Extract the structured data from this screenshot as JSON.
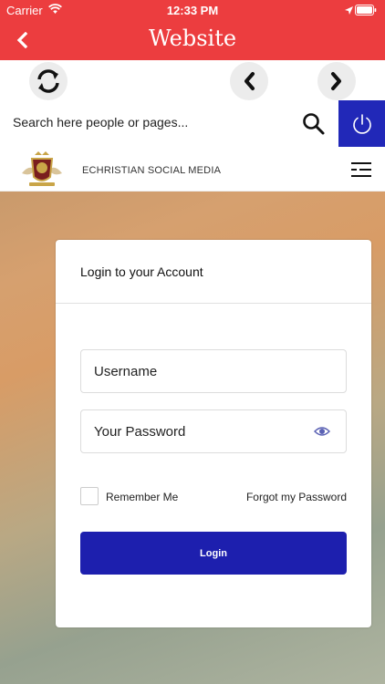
{
  "status_bar": {
    "carrier": "Carrier",
    "time": "12:33 PM"
  },
  "nav": {
    "title": "Website"
  },
  "search": {
    "placeholder": "Search here people or pages..."
  },
  "site": {
    "name": "ECHRISTIAN SOCIAL MEDIA"
  },
  "login": {
    "title": "Login to your Account",
    "username_placeholder": "Username",
    "password_placeholder": "Your Password",
    "remember_label": "Remember Me",
    "forgot_label": "Forgot my Password",
    "button_label": "Login"
  },
  "colors": {
    "header_red": "#ec3d3f",
    "power_blue": "#2128b8",
    "login_blue": "#1d1fae"
  },
  "icons": [
    "wifi-icon",
    "location-icon",
    "battery-icon",
    "back-chevron-icon",
    "refresh-icon",
    "chevron-left-icon",
    "chevron-right-icon",
    "search-icon",
    "power-icon",
    "menu-icon",
    "eye-icon"
  ]
}
